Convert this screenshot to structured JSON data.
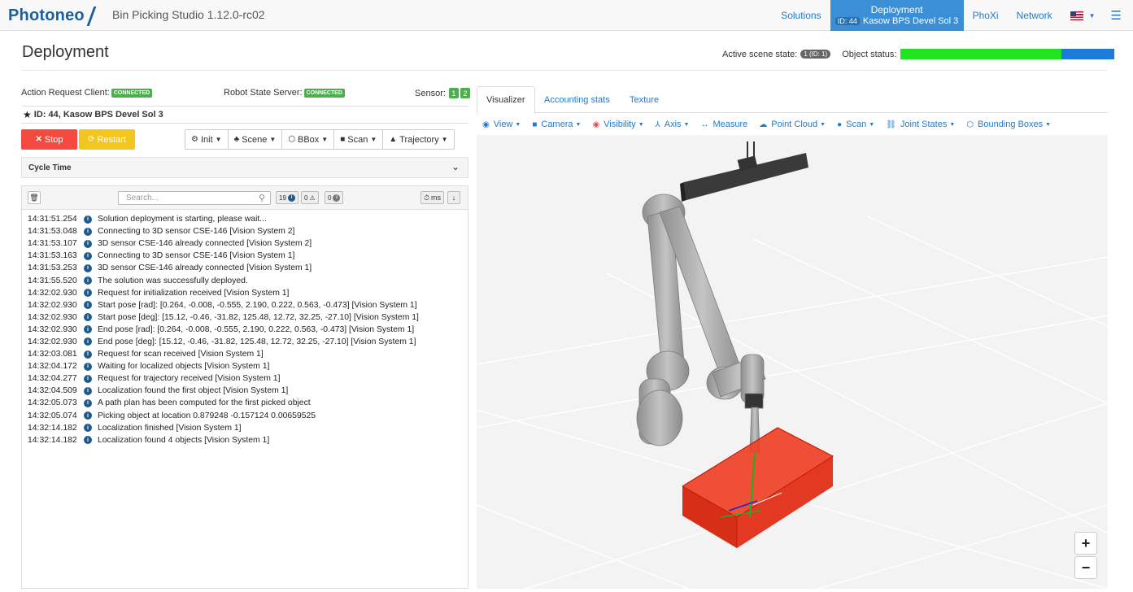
{
  "navbar": {
    "logo_text": "Photoneo",
    "app_title": "Bin Picking Studio 1.12.0-rc02",
    "links": {
      "solutions": "Solutions",
      "phoxi": "PhoXi",
      "network": "Network"
    },
    "active": {
      "title": "Deployment",
      "id_badge": "ID: 44",
      "solution_name": "Kasow BPS Devel Sol 3"
    },
    "language_flag": "us-flag-icon",
    "menu_icon": "hamburger-icon"
  },
  "header": {
    "title": "Deployment",
    "active_scene_label": "Active scene state:",
    "active_scene_badge": "1 (ID: 1)",
    "object_status_label": "Object status:",
    "object_status": {
      "green_fraction": 0.753,
      "blue_fraction": 0.247,
      "green_color": "#22e31f",
      "blue_color": "#1c7bd9"
    }
  },
  "status": {
    "action_request_label": "Action Request Client:",
    "action_request_state": "CONNECTED",
    "robot_state_label": "Robot State Server:",
    "robot_state_state": "CONNECTED",
    "sensor_label": "Sensor:",
    "sensors": [
      "1",
      "2"
    ]
  },
  "solution": {
    "label": "ID: 44, Kasow BPS Devel Sol 3"
  },
  "controls": {
    "stop": "Stop",
    "restart": "Restart",
    "init": "Init",
    "scene": "Scene",
    "bbox": "BBox",
    "scan": "Scan",
    "trajectory": "Trajectory"
  },
  "cycle_time": {
    "label": "Cycle Time"
  },
  "log": {
    "search_placeholder": "Search...",
    "info_count": "19",
    "warn_count": "0",
    "error_count": "0",
    "ms_label": "ms",
    "entries": [
      {
        "time": "14:31:51.254",
        "msg": "Solution deployment is starting, please wait..."
      },
      {
        "time": "14:31:53.048",
        "msg": "Connecting to 3D sensor CSE-146 [Vision System 2]"
      },
      {
        "time": "14:31:53.107",
        "msg": "3D sensor CSE-146 already connected [Vision System 2]"
      },
      {
        "time": "14:31:53.163",
        "msg": "Connecting to 3D sensor CSE-146 [Vision System 1]"
      },
      {
        "time": "14:31:53.253",
        "msg": "3D sensor CSE-146 already connected [Vision System 1]"
      },
      {
        "time": "14:31:55.520",
        "msg": "The solution was successfully deployed."
      },
      {
        "time": "14:32:02.930",
        "msg": "Request for initialization received [Vision System 1]"
      },
      {
        "time": "14:32:02.930",
        "msg": "Start pose [rad]: [0.264, -0.008, -0.555, 2.190, 0.222, 0.563, -0.473] [Vision System 1]"
      },
      {
        "time": "14:32:02.930",
        "msg": "Start pose [deg]: [15.12, -0.46, -31.82, 125.48, 12.72, 32.25, -27.10] [Vision System 1]"
      },
      {
        "time": "14:32:02.930",
        "msg": "End pose [rad]: [0.264, -0.008, -0.555, 2.190, 0.222, 0.563, -0.473] [Vision System 1]"
      },
      {
        "time": "14:32:02.930",
        "msg": "End pose [deg]: [15.12, -0.46, -31.82, 125.48, 12.72, 32.25, -27.10] [Vision System 1]"
      },
      {
        "time": "14:32:03.081",
        "msg": "Request for scan received [Vision System 1]"
      },
      {
        "time": "14:32:04.172",
        "msg": "Waiting for localized objects [Vision System 1]"
      },
      {
        "time": "14:32:04.277",
        "msg": "Request for trajectory received [Vision System 1]"
      },
      {
        "time": "14:32:04.509",
        "msg": "Localization found the first object [Vision System 1]"
      },
      {
        "time": "14:32:05.073",
        "msg": "A path plan has been computed for the first picked object"
      },
      {
        "time": "14:32:05.074",
        "msg": "Picking object at location 0.879248 -0.157124 0.00659525"
      },
      {
        "time": "14:32:14.182",
        "msg": "Localization finished [Vision System 1]"
      },
      {
        "time": "14:32:14.182",
        "msg": "Localization found 4 objects [Vision System 1]"
      }
    ]
  },
  "tabs": [
    "Visualizer",
    "Accounting stats",
    "Texture"
  ],
  "viz_toolbar": {
    "view": "View",
    "camera": "Camera",
    "visibility": "Visibility",
    "axis": "Axis",
    "measure": "Measure",
    "point_cloud": "Point Cloud",
    "scan": "Scan",
    "joint_states": "Joint States",
    "bounding_boxes": "Bounding Boxes"
  },
  "zoom": {
    "in": "+",
    "out": "−"
  },
  "colors": {
    "accent": "#3a8fd6",
    "link": "#1f7acc",
    "stop": "#f44b40",
    "restart": "#f3c51f",
    "connected": "#4cae4c",
    "bin": "#e8321a"
  }
}
